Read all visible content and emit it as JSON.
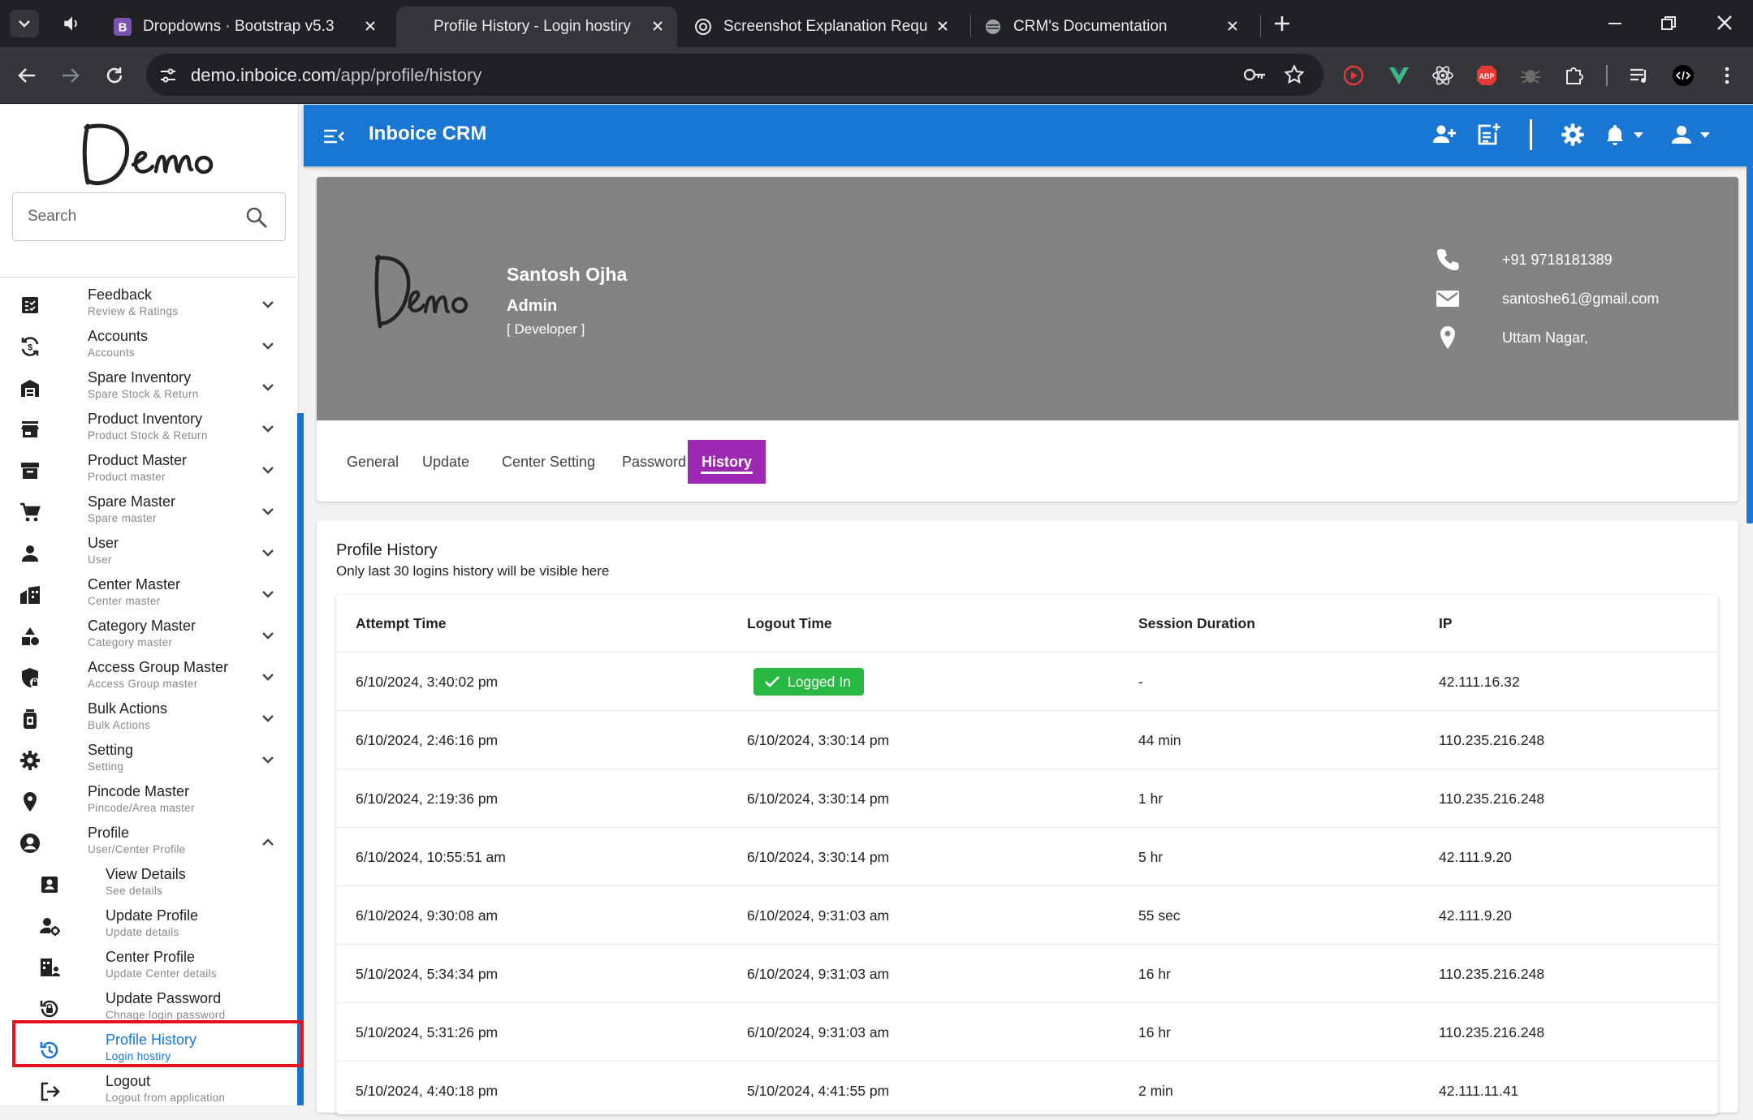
{
  "browser": {
    "tabs": [
      {
        "title": "Dropdowns · Bootstrap v5.3",
        "favicon": "bootstrap-icon",
        "active": false
      },
      {
        "title": "Profile History - Login hostiry | c",
        "favicon": "none",
        "active": true
      },
      {
        "title": "Screenshot Explanation Request",
        "favicon": "chatgpt-icon",
        "active": false
      },
      {
        "title": "CRM's Documentation",
        "favicon": "globe-icon",
        "active": false
      }
    ],
    "url_host": "demo.inboice.com",
    "url_path": "/app/profile/history"
  },
  "sidebar": {
    "logo_text": "Demo",
    "search_placeholder": "Search",
    "menu": [
      {
        "label": "Feedback",
        "sub": "Review & Ratings",
        "icon": "feedback-icon"
      },
      {
        "label": "Accounts",
        "sub": "Accounts",
        "icon": "accounts-sync-icon"
      },
      {
        "label": "Spare Inventory",
        "sub": "Spare Stock & Return",
        "icon": "warehouse-icon"
      },
      {
        "label": "Product Inventory",
        "sub": "Product Stock & Return",
        "icon": "store-icon"
      },
      {
        "label": "Product Master",
        "sub": "Product master",
        "icon": "archive-icon"
      },
      {
        "label": "Spare Master",
        "sub": "Spare master",
        "icon": "cart-icon"
      },
      {
        "label": "User",
        "sub": "User",
        "icon": "person-icon"
      },
      {
        "label": "Center Master",
        "sub": "Center master",
        "icon": "building-icon"
      },
      {
        "label": "Category Master",
        "sub": "Category master",
        "icon": "category-icon"
      },
      {
        "label": "Access Group Master",
        "sub": "Access Group master",
        "icon": "shield-lock-icon"
      },
      {
        "label": "Bulk Actions",
        "sub": "Bulk Actions",
        "icon": "bulk-actions-icon"
      },
      {
        "label": "Setting",
        "sub": "Setting",
        "icon": "gear-icon"
      },
      {
        "label": "Pincode Master",
        "sub": "Pincode/Area master",
        "icon": "location-pin-icon"
      },
      {
        "label": "Profile",
        "sub": "User/Center Profile",
        "icon": "account-circle-icon"
      }
    ],
    "profile_submenu": [
      {
        "label": "View Details",
        "sub": "See details",
        "icon": "contact-card-icon"
      },
      {
        "label": "Update Profile",
        "sub": "Update details",
        "icon": "manage-account-icon"
      },
      {
        "label": "Center Profile",
        "sub": "Update Center details",
        "icon": "center-profile-icon"
      },
      {
        "label": "Update Password",
        "sub": "Chnage login password",
        "icon": "lock-reset-icon"
      },
      {
        "label": "Profile History",
        "sub": "Login hostiry",
        "icon": "history-icon",
        "active": true
      },
      {
        "label": "Logout",
        "sub": "Logout from application",
        "icon": "logout-icon"
      }
    ],
    "active_color": "#1976d2"
  },
  "appbar": {
    "title": "Inboice CRM",
    "color": "#1976d2",
    "icons": [
      "menu-open-icon",
      "add-user-icon",
      "post-add-icon",
      "gear-icon",
      "bell-icon",
      "account-icon"
    ]
  },
  "profile": {
    "logo_text": "Demo",
    "name": "Santosh Ojha",
    "role": "Admin",
    "department": "[ Developer ]",
    "phone": "+91 9718181389",
    "email": "santoshe61@gmail.com",
    "address": "Uttam Nagar,",
    "banner_color": "#838383",
    "tabs": [
      {
        "label": "General"
      },
      {
        "label": "Update"
      },
      {
        "label": "Center Setting"
      },
      {
        "label": "Password"
      },
      {
        "label": "History",
        "active": true
      }
    ],
    "active_tab_color": "#9c27b0"
  },
  "history": {
    "title": "Profile History",
    "subtitle": "Only last 30 logins history will be visible here",
    "columns": [
      "Attempt Time",
      "Logout Time",
      "Session Duration",
      "IP"
    ],
    "logged_in_label": "Logged In",
    "logged_in_color": "#28b943",
    "rows": [
      {
        "attempt": "6/10/2024, 3:40:02 pm",
        "logout": "",
        "logged_in": true,
        "duration": "-",
        "ip": "42.111.16.32"
      },
      {
        "attempt": "6/10/2024, 2:46:16 pm",
        "logout": "6/10/2024, 3:30:14 pm",
        "logged_in": false,
        "duration": "44 min",
        "ip": "110.235.216.248"
      },
      {
        "attempt": "6/10/2024, 2:19:36 pm",
        "logout": "6/10/2024, 3:30:14 pm",
        "logged_in": false,
        "duration": "1 hr",
        "ip": "110.235.216.248"
      },
      {
        "attempt": "6/10/2024, 10:55:51 am",
        "logout": "6/10/2024, 3:30:14 pm",
        "logged_in": false,
        "duration": "5 hr",
        "ip": "42.111.9.20"
      },
      {
        "attempt": "6/10/2024, 9:30:08 am",
        "logout": "6/10/2024, 9:31:03 am",
        "logged_in": false,
        "duration": "55 sec",
        "ip": "42.111.9.20"
      },
      {
        "attempt": "5/10/2024, 5:34:34 pm",
        "logout": "6/10/2024, 9:31:03 am",
        "logged_in": false,
        "duration": "16 hr",
        "ip": "110.235.216.248"
      },
      {
        "attempt": "5/10/2024, 5:31:26 pm",
        "logout": "6/10/2024, 9:31:03 am",
        "logged_in": false,
        "duration": "16 hr",
        "ip": "110.235.216.248"
      },
      {
        "attempt": "5/10/2024, 4:40:18 pm",
        "logout": "5/10/2024, 4:41:55 pm",
        "logged_in": false,
        "duration": "2 min",
        "ip": "42.111.11.41"
      }
    ]
  }
}
